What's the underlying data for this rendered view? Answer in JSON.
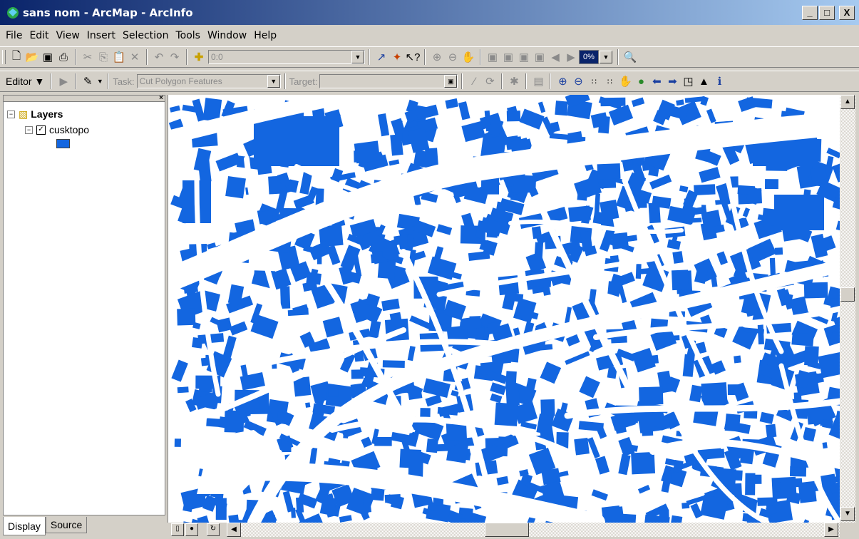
{
  "window": {
    "title": "sans nom - ArcMap - ArcInfo",
    "minimize": "_",
    "maximize": "□",
    "close": "X"
  },
  "menu": [
    "File",
    "Edit",
    "View",
    "Insert",
    "Selection",
    "Tools",
    "Window",
    "Help"
  ],
  "standard_toolbar": {
    "icons": [
      "new-icon",
      "open-icon",
      "save-icon",
      "print-icon",
      "cut-icon",
      "copy-icon",
      "paste-icon",
      "delete-icon",
      "undo-icon",
      "redo-icon",
      "add-data-icon"
    ],
    "scale_value": "0:0",
    "zoom_percent": "0%"
  },
  "editor_toolbar": {
    "editor_label": "Editor",
    "task_label": "Task:",
    "task_value": "Cut Polygon Features",
    "target_label": "Target:",
    "target_value": ""
  },
  "toc": {
    "root_label": "Layers",
    "layer_name": "cusktopo",
    "layer_checked": true,
    "symbol_color": "#1366e0"
  },
  "tabs": {
    "display": "Display",
    "source": "Source"
  },
  "map": {
    "feature_color": "#1366e0",
    "background": "#ffffff"
  },
  "colors": {
    "titlebar_start": "#0a246a",
    "titlebar_end": "#a6caf0",
    "face": "#d4d0c8"
  }
}
